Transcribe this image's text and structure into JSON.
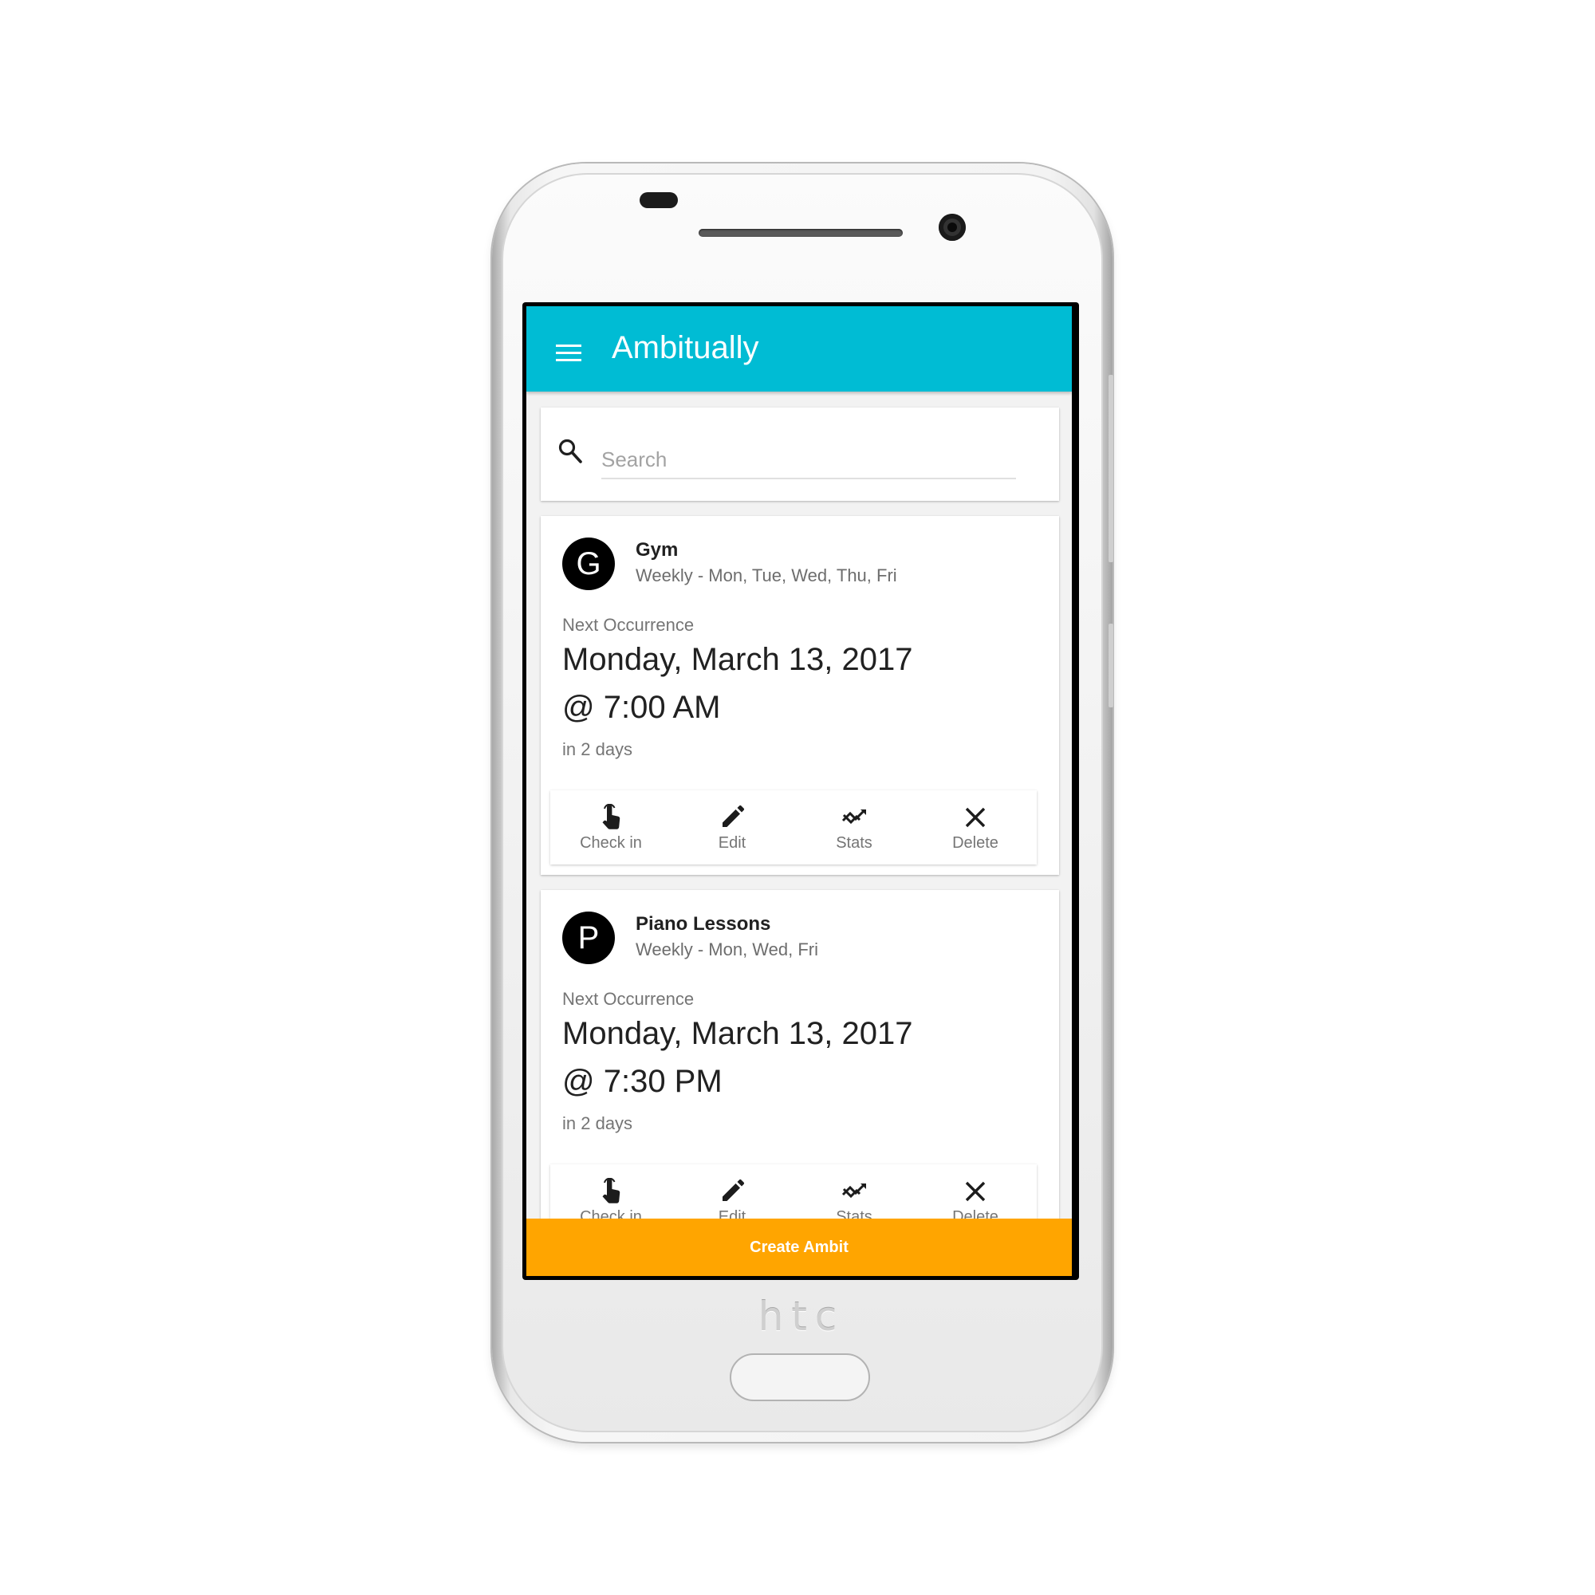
{
  "device": {
    "brand": "htc"
  },
  "app": {
    "title": "Ambitually",
    "accent_color": "#00bcd4",
    "button_color": "#ffa500"
  },
  "search": {
    "placeholder": "Search"
  },
  "icons": {
    "menu": "menu-icon",
    "search": "search-icon",
    "check_in": "touch-hand-icon",
    "edit": "pencil-icon",
    "stats": "trend-chart-icon",
    "delete": "close-icon"
  },
  "ambits": [
    {
      "initial": "G",
      "name": "Gym",
      "schedule": "Weekly - Mon, Tue, Wed, Thu, Fri",
      "next_label": "Next Occurrence",
      "next_date": "Monday, March 13, 2017",
      "next_time": "@ 7:00 AM",
      "relative": "in 2 days",
      "actions": {
        "check_in": "Check in",
        "edit": "Edit",
        "stats": "Stats",
        "delete": "Delete"
      }
    },
    {
      "initial": "P",
      "name": "Piano Lessons",
      "schedule": "Weekly - Mon, Wed, Fri",
      "next_label": "Next Occurrence",
      "next_date": "Monday, March 13, 2017",
      "next_time": "@ 7:30 PM",
      "relative": "in 2 days",
      "actions": {
        "check_in": "Check in",
        "edit": "Edit",
        "stats": "Stats",
        "delete": "Delete"
      }
    }
  ],
  "footer": {
    "create_label": "Create Ambit"
  }
}
